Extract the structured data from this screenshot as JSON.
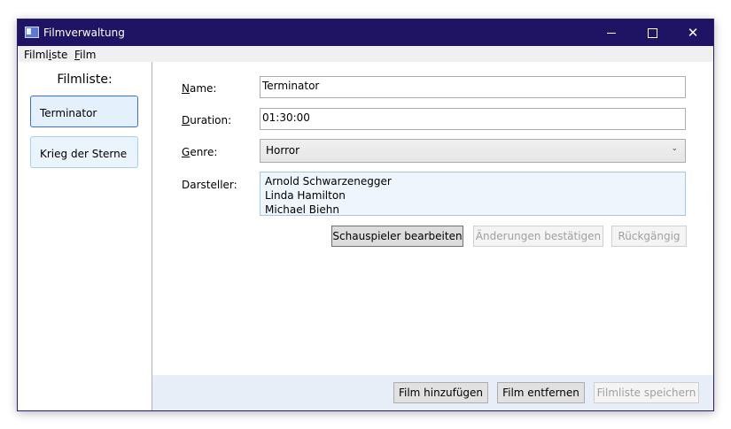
{
  "window": {
    "title": "Filmverwaltung",
    "controls": {
      "minimize": "—",
      "maximize": "☐",
      "close": "✕"
    }
  },
  "menu": [
    {
      "label": "Filmliste",
      "underline": 5
    },
    {
      "label": "Film",
      "underline": 0
    }
  ],
  "sidebar": {
    "title": "Filmliste:",
    "films": [
      {
        "label": "Terminator",
        "selected": true
      },
      {
        "label": "Krieg der Sterne",
        "selected": false
      }
    ]
  },
  "form": {
    "name_label": "Name:",
    "name_value": "Terminator",
    "duration_label": "Duration:",
    "duration_value": "01:30:00",
    "genre_label": "Genre:",
    "genre_value": "Horror",
    "actors_label": "Darsteller:",
    "actors": [
      "Arnold Schwarzenegger",
      "Linda Hamilton",
      "Michael Biehn"
    ]
  },
  "actions": {
    "edit_actors": "Schauspieler bearbeiten",
    "confirm_changes": "Änderungen bestätigen",
    "undo": "Rückgängig"
  },
  "footer": {
    "add_film": "Film hinzufügen",
    "remove_film": "Film entfernen",
    "save_list": "Filmliste speichern"
  },
  "colors": {
    "titlebar": "#1f1464",
    "footer_bg": "#e8eef7",
    "selection_border": "#3b6fdc",
    "disabled_text": "#a0a0a0"
  }
}
